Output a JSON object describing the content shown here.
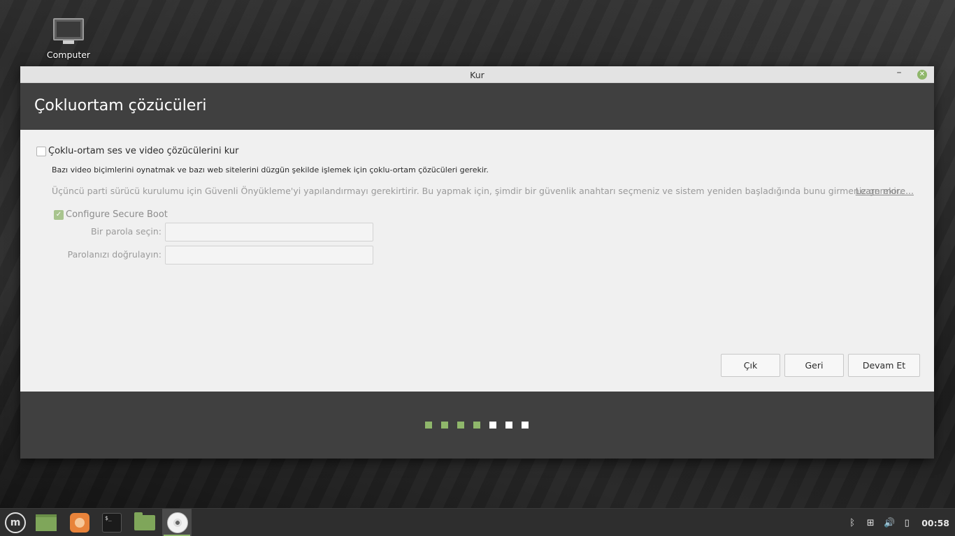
{
  "desktop": {
    "computer_icon_label": "Computer"
  },
  "window": {
    "title": "Kur",
    "minimize_glyph": "–",
    "close_glyph": "✕",
    "page_title": "Çokluortam çözücüleri",
    "install_codecs_label": "Çoklu-ortam ses ve video çözücülerini kur",
    "install_codecs_checked": false,
    "codecs_description": "Bazı video biçimlerini oynatmak ve bazı web sitelerini düzgün şekilde işlemek için çoklu-ortam çözücüleri gerekir.",
    "secure_boot_note": "Üçüncü parti sürücü kurulumu için Güvenli Önyükleme'yi yapılandırmayı gerekirtirir. Bu yapmak için, şimdir bir güvenlik anahtarı seçmeniz ve sistem yeniden başladığında bunu girmeniz gerekir.",
    "learn_more": "Learn more...",
    "configure_secure_boot_label": "Configure Secure Boot",
    "configure_secure_boot_checked": true,
    "password_label": "Bir parola seçin:",
    "password_value": "",
    "confirm_label": "Parolanızı doğrulayın:",
    "confirm_value": "",
    "buttons": {
      "quit": "Çık",
      "back": "Geri",
      "continue": "Devam Et"
    },
    "progress": {
      "completed_steps": 4,
      "total_steps": 7
    }
  },
  "taskbar": {
    "menu_icon": "mint-menu-icon",
    "launchers": [
      "show-desktop-icon",
      "firefox-icon",
      "terminal-icon",
      "files-icon",
      "installer-disc-icon"
    ],
    "terminal_glyph": "$_",
    "tray": {
      "bluetooth_glyph": "ᛒ",
      "network_glyph": "⊞",
      "volume_glyph": "🔊",
      "battery_glyph": "▯",
      "clock": "00:58"
    },
    "accent_color": "#8fb76b"
  },
  "colors": {
    "header_band": "#404040",
    "accent_green": "#8fb76b"
  }
}
